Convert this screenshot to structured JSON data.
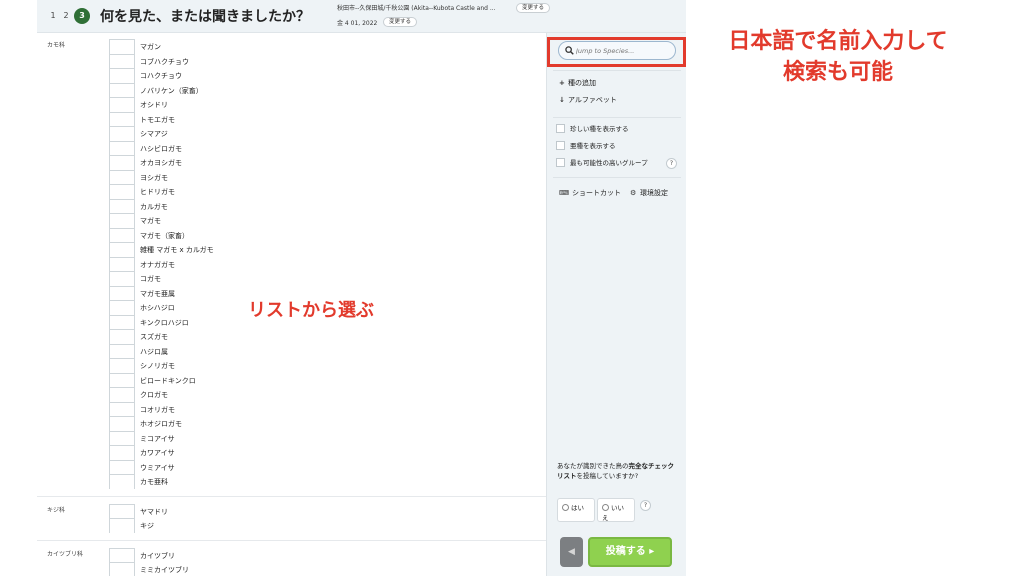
{
  "header": {
    "steps": [
      "1",
      "2",
      "3"
    ],
    "title": "何を見た、または聞きましたか？",
    "location": "秋田市--久保田城/千秋公園 (Akita--Kubota Castle and ...",
    "location_change": "変更する",
    "date": "金 4 01, 2022",
    "date_change": "変更する"
  },
  "families": [
    {
      "label": "カモ科",
      "species": [
        "マガン",
        "コブハクチョウ",
        "コハクチョウ",
        "ノバリケン（家畜）",
        "オシドリ",
        "トモエガモ",
        "シマアジ",
        "ハシビロガモ",
        "オカヨシガモ",
        "ヨシガモ",
        "ヒドリガモ",
        "カルガモ",
        "マガモ",
        "マガモ（家畜）",
        "雑種 マガモ x カルガモ",
        "オナガガモ",
        "コガモ",
        "マガモ亜属",
        "ホシハジロ",
        "キンクロハジロ",
        "スズガモ",
        "ハジロ属",
        "シノリガモ",
        "ビロードキンクロ",
        "クロガモ",
        "コオリガモ",
        "ホオジロガモ",
        "ミコアイサ",
        "カワアイサ",
        "ウミアイサ",
        "カモ亜科"
      ]
    },
    {
      "label": "キジ科",
      "species": [
        "ヤマドリ",
        "キジ"
      ]
    },
    {
      "label": "カイツブリ科",
      "species": [
        "カイツブリ",
        "ミミカイツブリ",
        "アカエリカイツブリ"
      ]
    }
  ],
  "sidebar": {
    "search_placeholder": "Jump to Species...",
    "add_species": "種の追加",
    "alphabet": "アルファベット",
    "show_rare": "珍しい種を表示する",
    "show_subspecies": "亜種を表示する",
    "most_likely_group": "最も可能性の高いグループ",
    "shortcuts": "ショートカット",
    "settings": "環境設定",
    "prompt_pre": "あなたが識別できた鳥の",
    "prompt_bold": "完全なチェックリスト",
    "prompt_post": "を投稿していますか?",
    "yes": "はい",
    "no": "いいえ",
    "help": "?",
    "back": "◀",
    "submit": "投稿する ▸"
  },
  "annotations": {
    "search_line1": "日本語で名前入力して",
    "search_line2": "検索も可能",
    "list": "リストから選ぶ"
  },
  "colors": {
    "accent_green": "#8fd14f",
    "annotation_red": "#e23a2c",
    "step_active": "#2f6f36"
  }
}
